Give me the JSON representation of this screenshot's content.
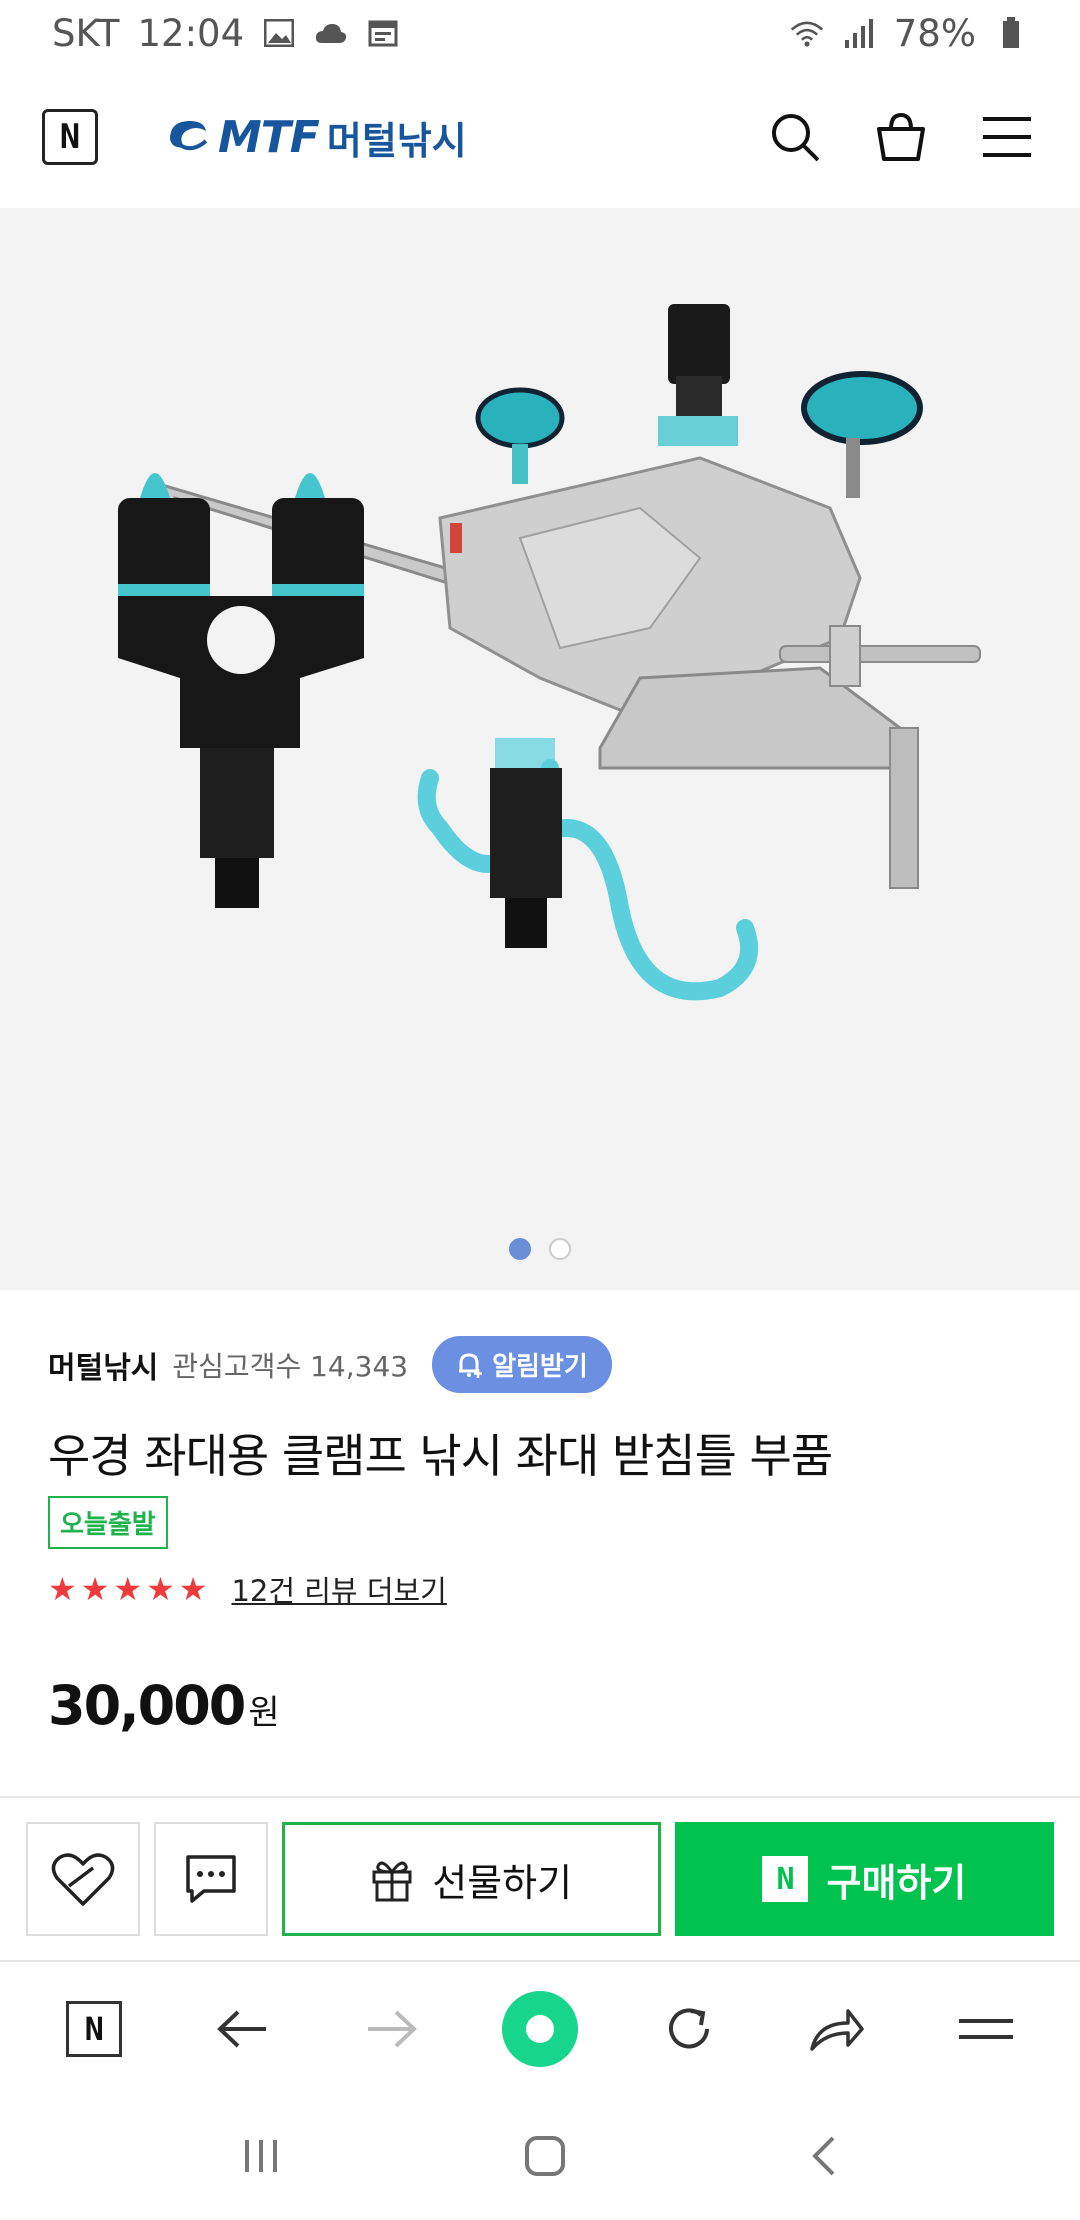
{
  "status": {
    "carrier": "SKT",
    "time": "12:04",
    "battery": "78%"
  },
  "header": {
    "n_label": "N",
    "brand_en": "MTF",
    "brand_ko": "머털낚시"
  },
  "product_image": {
    "page_count": 2,
    "current_page": 1
  },
  "store": {
    "name": "머털낚시",
    "interest": "관심고객수 14,343",
    "notify_label": "알림받기"
  },
  "product": {
    "title": "우경 좌대용 클램프 낚시 좌대 받침틀 부품",
    "badge": "오늘출발",
    "rating_stars": 5,
    "reviews_label": "12건 리뷰 더보기",
    "price": "30,000",
    "price_unit": "원"
  },
  "actions": {
    "gift_label": "선물하기",
    "buy_label": "구매하기",
    "buy_n": "N"
  },
  "browser": {
    "n_label": "N"
  },
  "colors": {
    "brand": "#17569d",
    "accent_green": "#00c34f",
    "notify_blue": "#6b8fe1",
    "star_red": "#ef3b3b"
  }
}
